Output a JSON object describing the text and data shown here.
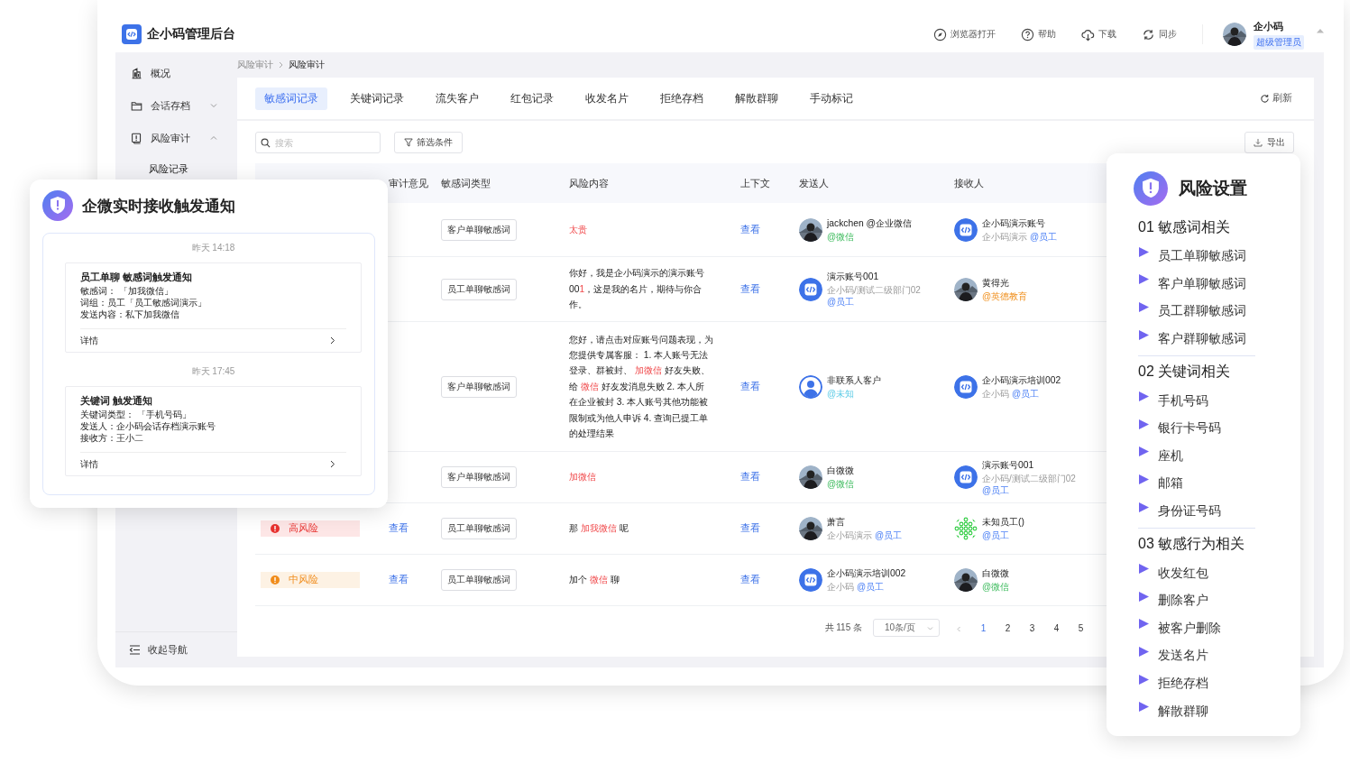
{
  "app": {
    "title": "企小码管理后台"
  },
  "header": {
    "actions": [
      {
        "label": "浏览器打开"
      },
      {
        "label": "帮助"
      },
      {
        "label": "下载"
      },
      {
        "label": "同步"
      }
    ],
    "user": {
      "name": "企小码",
      "role": "超级管理员"
    }
  },
  "sidebar": {
    "items": [
      {
        "label": "概况"
      },
      {
        "label": "会话存档",
        "expanded": false
      },
      {
        "label": "风险审计",
        "expanded": true,
        "children": [
          {
            "label": "风险记录"
          }
        ]
      }
    ],
    "collapse": "收起导航"
  },
  "breadcrumb": [
    "风险审计",
    "风险审计"
  ],
  "tabs": [
    {
      "label": "敏感词记录",
      "selected": true
    },
    {
      "label": "关键词记录",
      "selected": false
    },
    {
      "label": "流失客户",
      "selected": false
    },
    {
      "label": "红包记录",
      "selected": false
    },
    {
      "label": "收发名片",
      "selected": false
    },
    {
      "label": "拒绝存档",
      "selected": false
    },
    {
      "label": "解散群聊",
      "selected": false
    },
    {
      "label": "手动标记",
      "selected": false
    }
  ],
  "refresh": "刷新",
  "search": {
    "placeholder": "搜索"
  },
  "filter": "筛选条件",
  "export": "导出",
  "table": {
    "columns": [
      {
        "kind": "result"
      },
      {
        "kind": "opinion",
        "label": "审计意见"
      },
      {
        "kind": "type",
        "label": "敏感词类型"
      },
      {
        "kind": "content",
        "label": "风险内容"
      },
      {
        "kind": "context",
        "label": "上下文"
      },
      {
        "kind": "sender",
        "label": "发送人"
      },
      {
        "kind": "receiver",
        "label": "接收人"
      }
    ],
    "rows": [
      {
        "type": "客户单聊敏感词",
        "content": [
          {
            "text": "太贵",
            "hit": true
          }
        ],
        "context": "查看",
        "sender": {
          "name": "jackchen @企业微信",
          "tag": {
            "text": "@微信",
            "kind": "wechat"
          }
        },
        "receiver": {
          "avatar": {
            "kind": "logo"
          },
          "name": "企小码演示账号",
          "org": "企小码演示",
          "tag": {
            "text": "@员工",
            "kind": "staff"
          }
        }
      },
      {
        "type": "员工单聊敏感词",
        "content": [
          {
            "text": "你好，我是企小码演示的演示账号00",
            "hit": false
          },
          {
            "text": "1",
            "hit": true
          },
          {
            "text": "，这是我的名片，期待与你合作。",
            "hit": false
          }
        ],
        "context": "查看",
        "sender": {
          "avatar": {
            "kind": "logo"
          },
          "name": "演示账号001",
          "org": "企小码/测试二级部门02",
          "tag": {
            "text": "@员工",
            "kind": "staff"
          }
        },
        "receiver": {
          "name": "黄得光",
          "tag": {
            "text": "@英德教育",
            "kind": "org"
          }
        }
      },
      {
        "type": "客户单聊敏感词",
        "content": [
          {
            "text": "您好，请点击对应账号问题表现，为您提供专属客服： 1. 本人账号无法登录、群被封、 ",
            "hit": false
          },
          {
            "text": "加微信",
            "hit": true
          },
          {
            "text": " 好友失败、给 ",
            "hit": false
          },
          {
            "text": "微信",
            "hit": true
          },
          {
            "text": " 好友发消息失败 2. 本人所在企业被封 3. 本人账号其他功能被限制或为他人申诉 4. 查询已提工单的处理结果",
            "hit": false
          }
        ],
        "context": "查看",
        "sender": {
          "avatar": {
            "kind": "person"
          },
          "name": "非联系人客户",
          "tag": {
            "text": "@未知",
            "kind": "unknown"
          }
        },
        "receiver": {
          "avatar": {
            "kind": "logo"
          },
          "name": "企小码演示培训002",
          "org": "企小码",
          "tag": {
            "text": "@员工",
            "kind": "staff"
          }
        }
      },
      {
        "type": "客户单聊敏感词",
        "content": [
          {
            "text": "加微信",
            "hit": true
          }
        ],
        "context": "查看",
        "sender": {
          "name": "白微微",
          "tag": {
            "text": "@微信",
            "kind": "wechat"
          }
        },
        "receiver": {
          "avatar": {
            "kind": "logo"
          },
          "name": "演示账号001",
          "org": "企小码/测试二级部门02",
          "tag": {
            "text": "@员工",
            "kind": "staff"
          }
        }
      },
      {
        "result": {
          "kind": "high",
          "label": "高风险"
        },
        "opinion": "查看",
        "type": "员工单聊敏感词",
        "content": [
          {
            "text": "那 ",
            "hit": false
          },
          {
            "text": "加我微信",
            "hit": true
          },
          {
            "text": " 呢",
            "hit": false
          }
        ],
        "context": "查看",
        "sender": {
          "name": "萧言",
          "org": "企小码演示",
          "tag": {
            "text": "@员工",
            "kind": "staff"
          }
        },
        "receiver": {
          "avatar": {
            "kind": "pattern"
          },
          "name": "未知员工()",
          "tag": {
            "text": "@员工",
            "kind": "staff"
          }
        }
      },
      {
        "result": {
          "kind": "medium",
          "label": "中风险"
        },
        "opinion": "查看",
        "type": "员工单聊敏感词",
        "content": [
          {
            "text": "加个 ",
            "hit": false
          },
          {
            "text": "微信",
            "hit": true
          },
          {
            "text": " 聊",
            "hit": false
          }
        ],
        "context": "查看",
        "sender": {
          "avatar": {
            "kind": "logo"
          },
          "name": "企小码演示培训002",
          "org": "企小码",
          "tag": {
            "text": "@员工",
            "kind": "staff"
          }
        },
        "receiver": {
          "name": "白微微",
          "tag": {
            "text": "@微信",
            "kind": "wechat"
          }
        }
      }
    ]
  },
  "pagination": {
    "total": "共 115 条",
    "page_size": "10条/页",
    "pages": [
      {
        "label": "1",
        "selected": true
      },
      {
        "label": "2",
        "selected": false
      },
      {
        "label": "3",
        "selected": false
      },
      {
        "label": "4",
        "selected": false
      },
      {
        "label": "5",
        "selected": false
      }
    ]
  },
  "notification_panel": {
    "title": "企微实时接收触发通知",
    "messages": [
      {
        "time": "昨天 14:18",
        "title": "员工单聊 敏感词触发通知",
        "lines": [
          "敏感词： 「加我微信」",
          "词组：员工「员工敏感词演示」",
          "发送内容：私下加我微信"
        ],
        "link": "详情"
      },
      {
        "time": "昨天 17:45",
        "title": "关键词 触发通知",
        "lines": [
          "关键词类型： 「手机号码」",
          "发送人：企小码会话存档演示账号",
          "接收方：王小二"
        ],
        "link": "详情"
      }
    ]
  },
  "risk_settings": {
    "title": "风险设置",
    "sections": [
      {
        "heading": "01 敏感词相关",
        "items": [
          "员工单聊敏感词",
          "客户单聊敏感词",
          "员工群聊敏感词",
          "客户群聊敏感词"
        ]
      },
      {
        "heading": "02 关键词相关",
        "items": [
          "手机号码",
          "银行卡号码",
          "座机",
          "邮箱",
          "身份证号码"
        ]
      },
      {
        "heading": "03 敏感行为相关",
        "items": [
          "收发红包",
          "删除客户",
          "被客户删除",
          "发送名片",
          "拒绝存档",
          "解散群聊"
        ]
      }
    ]
  }
}
